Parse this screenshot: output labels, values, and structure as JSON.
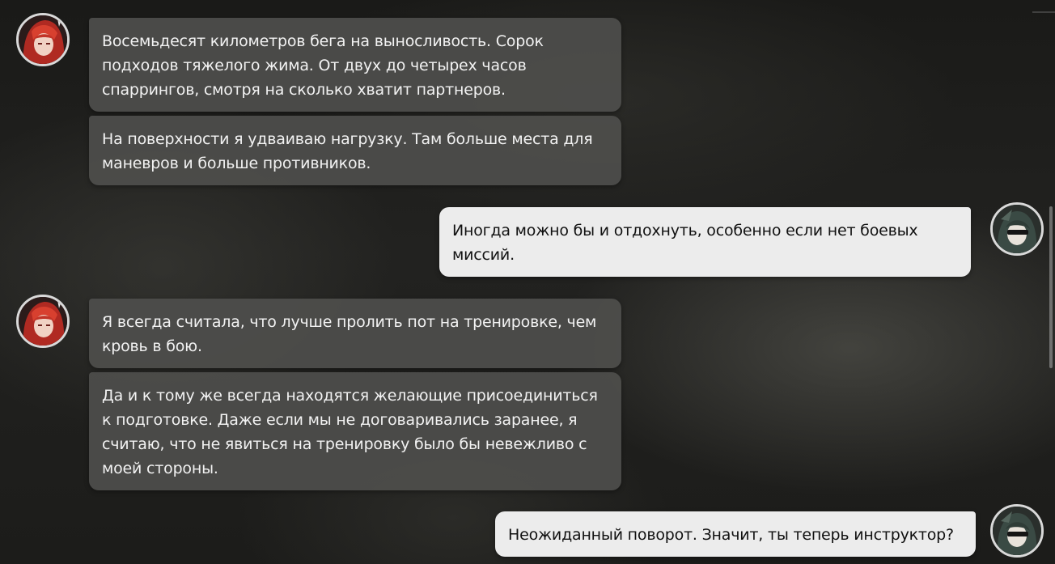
{
  "messages": [
    {
      "from": "character",
      "text": "Восемьдесят километров бега на выносливость. Сорок подходов тяжелого жима. От двух до четырех часов спаррингов, смотря на сколько хватит партнеров."
    },
    {
      "from": "character",
      "text": "На поверхности я удваиваю нагрузку. Там больше места для маневров и больше противников."
    },
    {
      "from": "player",
      "text": "Иногда можно бы и отдохнуть, особенно если нет боевых миссий."
    },
    {
      "from": "character",
      "text": "Я всегда считала, что лучше пролить пот на тренировке, чем кровь в бою."
    },
    {
      "from": "character",
      "text": "Да и к тому же всегда находятся желающие присоединиться к подготовке. Даже если мы не договаривались заранее, я считаю, что не явиться на тренировку было бы невежливо с моей стороны."
    },
    {
      "from": "player",
      "text": "Неожиданный поворот. Значит, ты теперь инструктор?"
    }
  ],
  "colors": {
    "incoming_bubble": "#4e4e4c",
    "outgoing_bubble": "#ececec",
    "character_hair": "#c8362a",
    "player_hair": "#3a4a44"
  }
}
